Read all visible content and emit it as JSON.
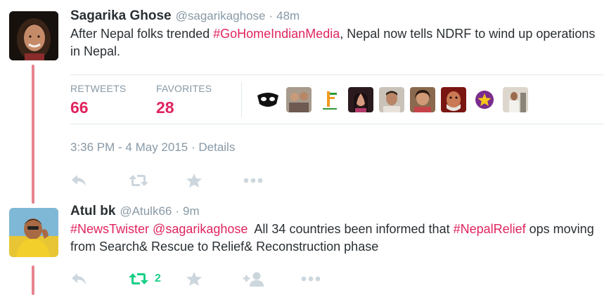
{
  "tweet1": {
    "fullname": "Sagarika Ghose",
    "username": "@sagarikaghose",
    "separator": "·",
    "time": "48m",
    "text_before": "After Nepal folks trended ",
    "hashtag": "#GoHomeIndianMedia",
    "text_after": ", Nepal now tells NDRF to wind up operations in Nepal.",
    "retweets_label": "RETWEETS",
    "retweets_count": "66",
    "favorites_label": "FAVORITES",
    "favorites_count": "28",
    "timestamp": "3:36 PM - 4 May 2015 · Details",
    "actions": [
      "reply-icon",
      "retweet-icon",
      "favorite-icon",
      "more-icon"
    ]
  },
  "tweet2": {
    "fullname": "Atul bk",
    "username": "@Atulk66",
    "separator": "·",
    "time": "9m",
    "hashtag1": "#NewsTwister",
    "mention": "@sagarikaghose",
    "text_mid": "  All 34 countries been informed that ",
    "hashtag2": "#NepalRelief",
    "text_after": " ops moving from Search& Rescue to Relief& Reconstruction phase",
    "retweet_count": "2",
    "actions": [
      "reply-icon",
      "retweet-icon",
      "favorite-icon",
      "follow-icon",
      "more-icon"
    ]
  },
  "colors": {
    "accent": "#e0245e",
    "thread_line": "#e6848f",
    "muted": "#8899a6",
    "retweeted": "#19cf86",
    "icon": "#ccd6dd"
  }
}
